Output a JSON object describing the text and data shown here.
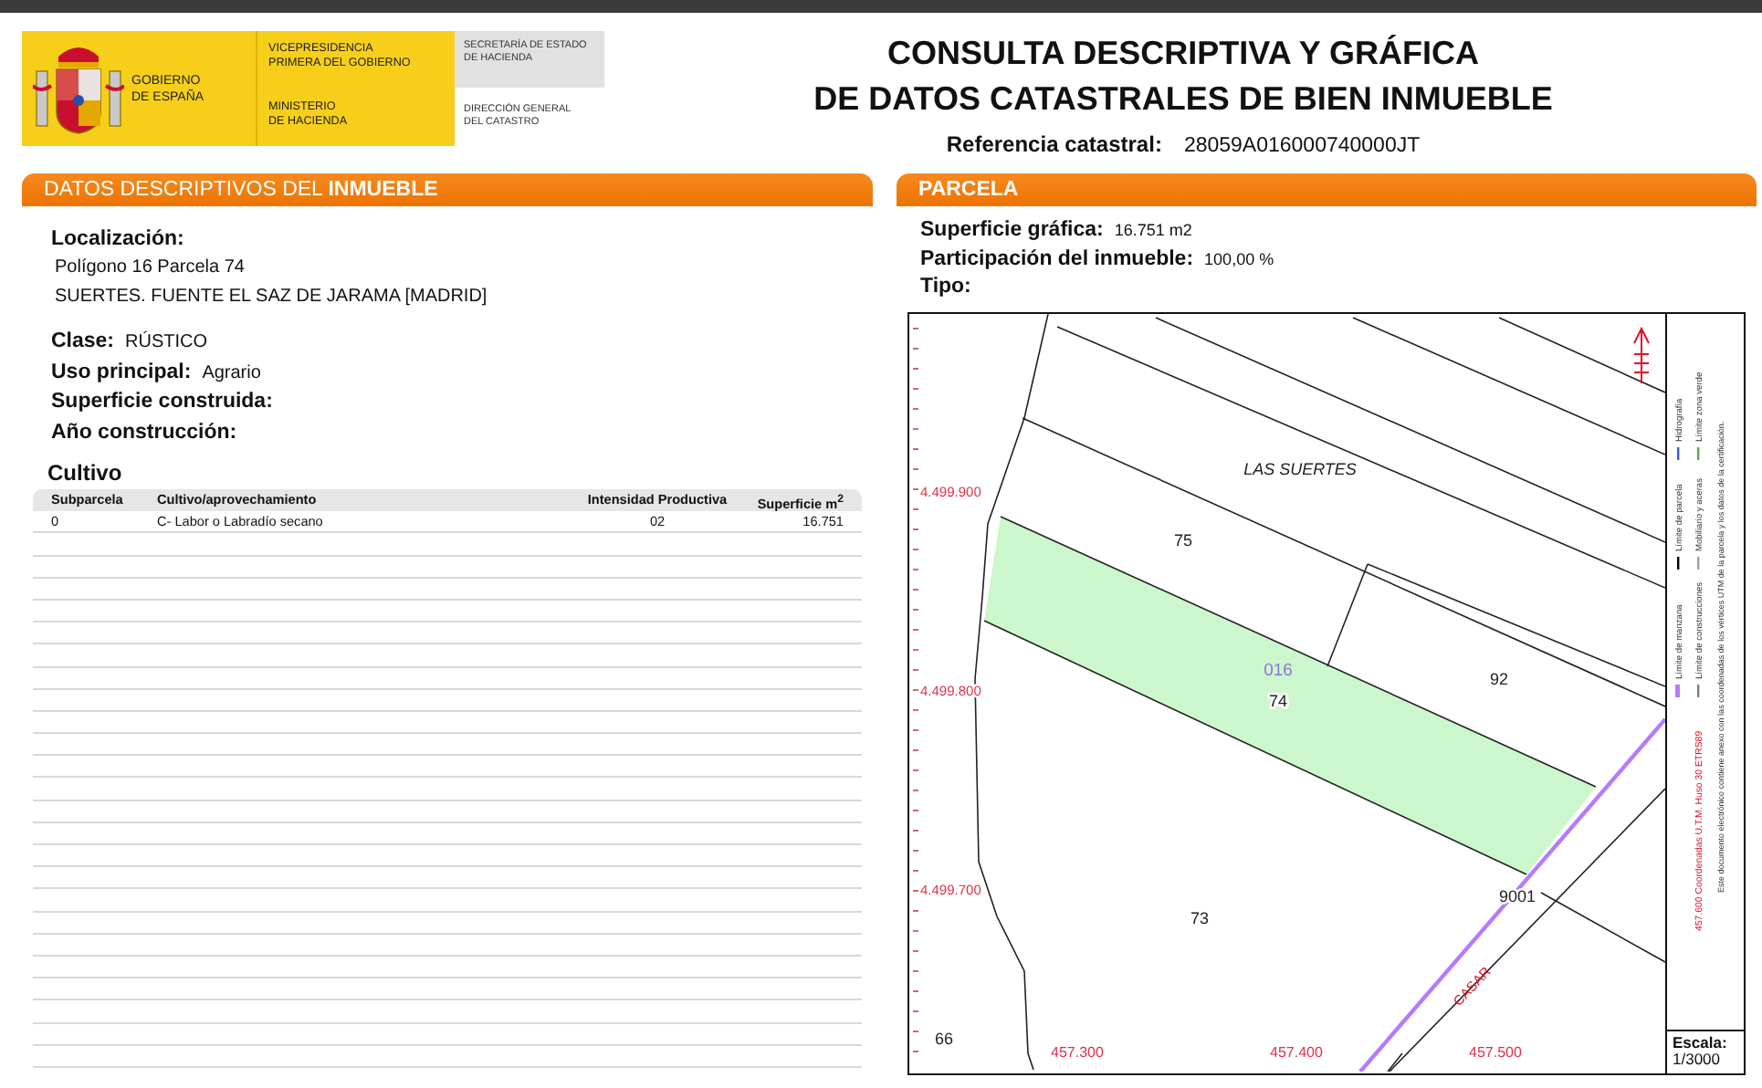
{
  "header": {
    "logo": {
      "government": "GOBIERNO\nDE ESPAÑA",
      "vicepresidency": "VICEPRESIDENCIA\nPRIMERA DEL GOBIERNO",
      "ministry": "MINISTERIO\nDE HACIENDA",
      "secretariat": "SECRETARÍA DE ESTADO\nDE HACIENDA",
      "directorate": "DIRECCIÓN GENERAL\nDEL CATASTRO"
    },
    "title_lines": [
      "CONSULTA DESCRIPTIVA Y GRÁFICA",
      "DE DATOS CATASTRALES DE BIEN INMUEBLE"
    ],
    "reference": {
      "label": "Referencia catastral:",
      "value": "28059A016000740000JT"
    }
  },
  "descriptive": {
    "title": "DATOS DESCRIPTIVOS DEL **INMUEBLE**",
    "location": {
      "label": "Localización:",
      "lines": [
        "Polígono 16 Parcela 74",
        "SUERTES. FUENTE EL SAZ DE JARAMA [MADRID]"
      ]
    },
    "fields": [
      {
        "label": "Clase:",
        "value": "RÚSTICO"
      },
      {
        "label": "Uso principal:",
        "value": "Agrario"
      },
      {
        "label": "Superficie construida:"
      },
      {
        "label": "Año construcción:"
      }
    ],
    "cultivo": {
      "title": "Cultivo",
      "columns": [
        "Subparcela",
        "Cultivo/aprovechamiento",
        "Intensidad Productiva",
        "Superficie m$^{2}$"
      ],
      "rows": [
        [
          "0",
          "C- Labor o Labradío secano",
          "02",
          "16.751"
        ]
      ]
    }
  },
  "parcela": {
    "title": "PARCELA",
    "fields": [
      {
        "label": "Superficie gráfica:",
        "value": "16.751 m2"
      },
      {
        "label": "Participación del inmueble:",
        "value": "100,00 %"
      },
      {
        "label": "Tipo:"
      }
    ],
    "map": {
      "labels": [
        {
          "text": "LAS SUERTES",
          "kind": "place"
        },
        {
          "text": "75",
          "kind": "parcel"
        },
        {
          "text": "016",
          "kind": "polygon"
        },
        {
          "text": "74",
          "kind": "parcel"
        },
        {
          "text": "92",
          "kind": "parcel"
        },
        {
          "text": "73",
          "kind": "parcel"
        },
        {
          "text": "9001",
          "kind": "parcel"
        },
        {
          "text": "CASAR",
          "kind": "street"
        },
        {
          "text": "66",
          "kind": "parcel"
        }
      ],
      "y_coords": [
        "4.499.900",
        "4.499.800",
        "4.499.700"
      ],
      "x_coords": [
        "457.300",
        "457.400",
        "457.500"
      ],
      "legend": [
        {
          "label": "Límite de manzana",
          "color": "#b57bff"
        },
        {
          "label": "Límite de parcela",
          "color": "#000000"
        },
        {
          "label": "Hidrografía",
          "color": "#3b5bd6"
        },
        {
          "label": "Límite de construcciones",
          "color": "#808080"
        },
        {
          "label": "Mobiliario y aceras",
          "color": "#a0a0a0"
        },
        {
          "label": "Límite zona verde",
          "color": "#4caf50"
        }
      ],
      "coordinates_note": "457.600 Coordenadas U.T.M. Huso 30 ETRS89",
      "disclaimer": "Este documento electrónico contiene anexo con las coordenadas de los vértices UTM de la parcela y los datos de la certificación.",
      "scale": {
        "label": "Escala:",
        "value": "1/3000"
      }
    }
  }
}
